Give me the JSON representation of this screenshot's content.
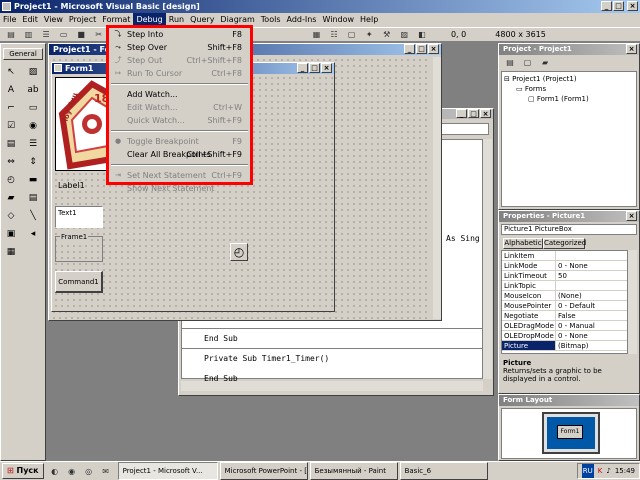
{
  "app": {
    "title": "Project1 - Microsoft Visual Basic [design]"
  },
  "menubar": [
    "File",
    "Edit",
    "View",
    "Project",
    "Format",
    "Debug",
    "Run",
    "Query",
    "Diagram",
    "Tools",
    "Add-Ins",
    "Window",
    "Help"
  ],
  "toolbar": {
    "pos": "0, 0",
    "size": "4800 x 3615"
  },
  "toolbox": {
    "title": "General"
  },
  "form_designer": {
    "title": "Project1 - Form1 (Form)",
    "form_title": "Form1",
    "label": "Label1",
    "textbox": "Text1",
    "frame": "Frame1",
    "button": "Command1",
    "logo_number": "18",
    "logo_text": "Моу Лиц"
  },
  "debug_menu": {
    "items": [
      {
        "label": "Step Into",
        "shortcut": "F8",
        "disabled": false
      },
      {
        "label": "Step Over",
        "shortcut": "Shift+F8",
        "disabled": false
      },
      {
        "label": "Step Out",
        "shortcut": "Ctrl+Shift+F8",
        "disabled": true
      },
      {
        "label": "Run To Cursor",
        "shortcut": "Ctrl+F8",
        "disabled": true
      },
      {
        "label": "Add Watch...",
        "shortcut": "",
        "disabled": false
      },
      {
        "label": "Edit Watch...",
        "shortcut": "Ctrl+W",
        "disabled": true
      },
      {
        "label": "Quick Watch...",
        "shortcut": "Shift+F9",
        "disabled": true
      },
      {
        "label": "Toggle Breakpoint",
        "shortcut": "F9",
        "disabled": true
      },
      {
        "label": "Clear All Breakpoints",
        "shortcut": "Ctrl+Shift+F9",
        "disabled": false
      },
      {
        "label": "Set Next Statement",
        "shortcut": "Ctrl+F9",
        "disabled": true
      },
      {
        "label": "Show Next Statement",
        "shortcut": "",
        "disabled": true
      }
    ]
  },
  "code_window": {
    "lines": [
      "End Sub",
      "Private Sub Timer1_Timer()",
      "End Sub"
    ],
    "partial": "As Sing"
  },
  "project_explorer": {
    "title": "Project - Project1",
    "root": "Project1 (Project1)",
    "folder": "Forms",
    "item": "Form1 (Form1)"
  },
  "properties": {
    "title": "Properties - Picture1",
    "object": "Picture1 PictureBox",
    "tab_alpha": "Alphabetic",
    "tab_cat": "Categorized",
    "rows": [
      {
        "name": "LinkItem",
        "value": ""
      },
      {
        "name": "LinkMode",
        "value": "0 - None"
      },
      {
        "name": "LinkTimeout",
        "value": "50"
      },
      {
        "name": "LinkTopic",
        "value": ""
      },
      {
        "name": "MouseIcon",
        "value": "(None)"
      },
      {
        "name": "MousePointer",
        "value": "0 - Default"
      },
      {
        "name": "Negotiate",
        "value": "False"
      },
      {
        "name": "OLEDragMode",
        "value": "0 - Manual"
      },
      {
        "name": "OLEDropMode",
        "value": "0 - None"
      },
      {
        "name": "Picture",
        "value": "(Bitmap)",
        "selected": true
      }
    ],
    "desc_title": "Picture",
    "desc_text": "Returns/sets a graphic to be displayed in a control."
  },
  "form_layout": {
    "title": "Form Layout",
    "form_label": "Form1"
  },
  "taskbar": {
    "start": "Пуск",
    "tasks": [
      "Project1 - Microsoft V...",
      "Microsoft PowerPoint - [...",
      "Безымянный - Paint",
      "Basic_6"
    ],
    "lang": "RU",
    "clock": "15:49"
  },
  "colors": {
    "highlight_box": "#ff0000",
    "title_active": "#0a246a",
    "selected_row": "#0a246a"
  }
}
